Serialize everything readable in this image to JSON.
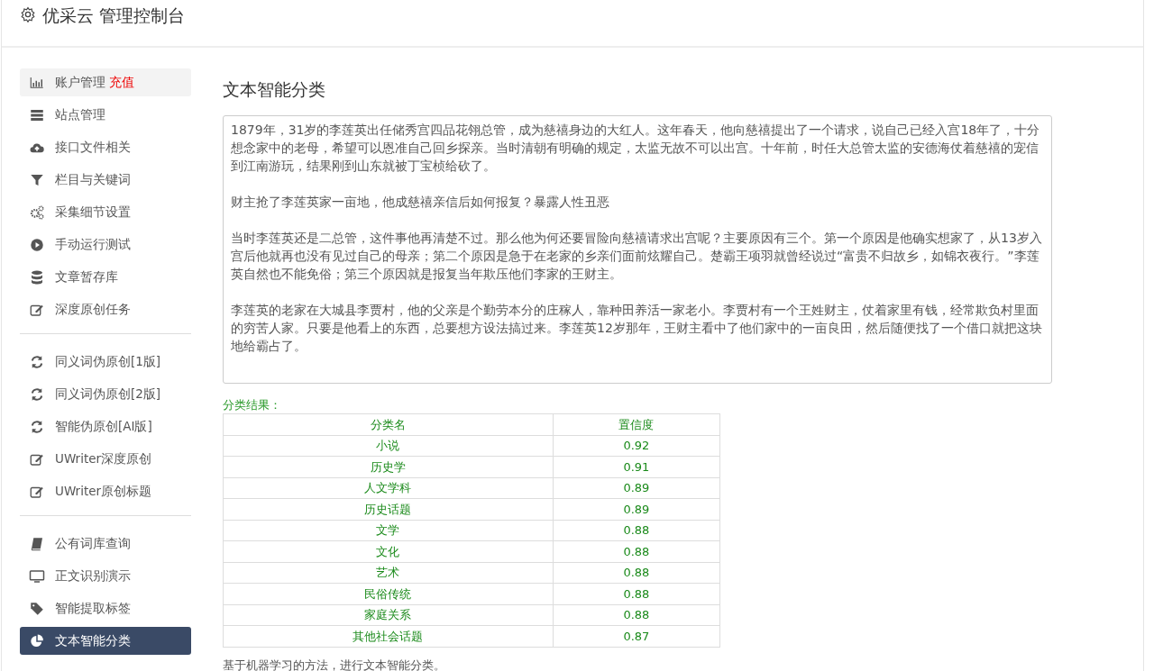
{
  "header": {
    "title": "优采云 管理控制台"
  },
  "sidebar": {
    "groups": [
      {
        "items": [
          {
            "label": "账户管理",
            "badge": "充值",
            "highlighted": true,
            "selected": false
          },
          {
            "label": "站点管理",
            "highlighted": false,
            "selected": false
          },
          {
            "label": "接口文件相关",
            "highlighted": false,
            "selected": false
          },
          {
            "label": "栏目与关键词",
            "highlighted": false,
            "selected": false
          },
          {
            "label": "采集细节设置",
            "highlighted": false,
            "selected": false
          },
          {
            "label": "手动运行测试",
            "highlighted": false,
            "selected": false
          },
          {
            "label": "文章暂存库",
            "highlighted": false,
            "selected": false
          },
          {
            "label": "深度原创任务",
            "highlighted": false,
            "selected": false
          }
        ]
      },
      {
        "items": [
          {
            "label": "同义词伪原创[1版]",
            "highlighted": false,
            "selected": false
          },
          {
            "label": "同义词伪原创[2版]",
            "highlighted": false,
            "selected": false
          },
          {
            "label": "智能伪原创[AI版]",
            "highlighted": false,
            "selected": false
          },
          {
            "label": "UWriter深度原创",
            "highlighted": false,
            "selected": false
          },
          {
            "label": "UWriter原创标题",
            "highlighted": false,
            "selected": false
          }
        ]
      },
      {
        "items": [
          {
            "label": "公有词库查询",
            "highlighted": false,
            "selected": false
          },
          {
            "label": "正文识别演示",
            "highlighted": false,
            "selected": false
          },
          {
            "label": "智能提取标签",
            "highlighted": false,
            "selected": false
          },
          {
            "label": "文本智能分类",
            "highlighted": false,
            "selected": true
          }
        ]
      }
    ]
  },
  "main": {
    "title": "文本智能分类",
    "input_text": [
      "1879年，31岁的李莲英出任储秀宫四品花翎总管，成为慈禧身边的大红人。这年春天，他向慈禧提出了一个请求，说自己已经入宫18年了，十分想念家中的老母，希望可以恩准自己回乡探亲。当时清朝有明确的规定，太监无故不可以出宫。十年前，时任大总管太监的安德海仗着慈禧的宠信到江南游玩，结果刚到山东就被丁宝桢给砍了。",
      "财主抢了李莲英家一亩地，他成慈禧亲信后如何报复？暴露人性丑恶",
      "当时李莲英还是二总管，这件事他再清楚不过。那么他为何还要冒险向慈禧请求出宫呢？主要原因有三个。第一个原因是他确实想家了，从13岁入宫后他就再也没有见过自己的母亲；第二个原因是急于在老家的乡亲们面前炫耀自己。楚霸王项羽就曾经说过“富贵不归故乡，如锦衣夜行。”李莲英自然也不能免俗；第三个原因就是报复当年欺压他们李家的王财主。",
      "李莲英的老家在大城县李贾村，他的父亲是个勤劳本分的庄稼人，靠种田养活一家老小。李贾村有一个王姓财主，仗着家里有钱，经常欺负村里面的穷苦人家。只要是他看上的东西，总要想方设法搞过来。李莲英12岁那年，王财主看中了他们家中的一亩良田，然后随便找了一个借口就把这块地给霸占了。"
    ],
    "result_label": "分类结果：",
    "table": {
      "columns": [
        "分类名",
        "置信度"
      ],
      "rows": [
        [
          "小说",
          "0.92"
        ],
        [
          "历史学",
          "0.91"
        ],
        [
          "人文学科",
          "0.89"
        ],
        [
          "历史话题",
          "0.89"
        ],
        [
          "文学",
          "0.88"
        ],
        [
          "文化",
          "0.88"
        ],
        [
          "艺术",
          "0.88"
        ],
        [
          "民俗传统",
          "0.88"
        ],
        [
          "家庭关系",
          "0.88"
        ],
        [
          "其他社会话题",
          "0.87"
        ]
      ]
    },
    "footer_note": "基于机器学习的方法，进行文本智能分类。"
  }
}
